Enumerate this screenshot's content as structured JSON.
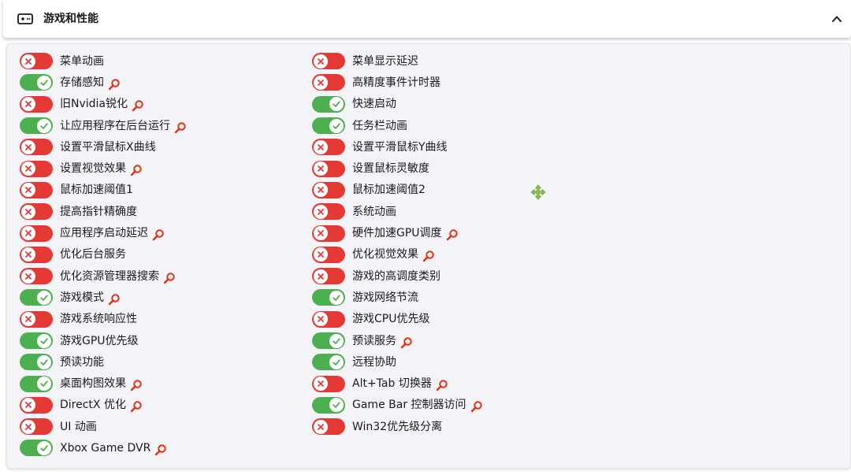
{
  "header": {
    "title": "游戏和性能",
    "icon": "gamepad-icon",
    "collapse_icon": "chevron-up-icon"
  },
  "colors": {
    "on": "#4caf50",
    "off": "#e53935",
    "search": "#e03010"
  },
  "left_items": [
    {
      "label": "菜单动画",
      "on": false,
      "search": false
    },
    {
      "label": "存储感知",
      "on": true,
      "search": true
    },
    {
      "label": "旧Nvidia锐化",
      "on": false,
      "search": true
    },
    {
      "label": "让应用程序在后台运行",
      "on": true,
      "search": true
    },
    {
      "label": "设置平滑鼠标X曲线",
      "on": false,
      "search": false
    },
    {
      "label": "设置视觉效果",
      "on": false,
      "search": true
    },
    {
      "label": "鼠标加速阈值1",
      "on": false,
      "search": false
    },
    {
      "label": "提高指针精确度",
      "on": false,
      "search": false
    },
    {
      "label": "应用程序启动延迟",
      "on": false,
      "search": true
    },
    {
      "label": "优化后台服务",
      "on": false,
      "search": false
    },
    {
      "label": "优化资源管理器搜索",
      "on": false,
      "search": true
    },
    {
      "label": "游戏模式",
      "on": true,
      "search": true
    },
    {
      "label": "游戏系统响应性",
      "on": false,
      "search": false
    },
    {
      "label": "游戏GPU优先级",
      "on": true,
      "search": false
    },
    {
      "label": "预读功能",
      "on": true,
      "search": false
    },
    {
      "label": "桌面构图效果",
      "on": true,
      "search": true
    },
    {
      "label": "DirectX 优化",
      "on": false,
      "search": true
    },
    {
      "label": "UI 动画",
      "on": false,
      "search": false
    },
    {
      "label": "Xbox Game DVR",
      "on": true,
      "search": true
    }
  ],
  "right_items": [
    {
      "label": "菜单显示延迟",
      "on": false,
      "search": false
    },
    {
      "label": "高精度事件计时器",
      "on": false,
      "search": false
    },
    {
      "label": "快速启动",
      "on": true,
      "search": false
    },
    {
      "label": "任务栏动画",
      "on": true,
      "search": false
    },
    {
      "label": "设置平滑鼠标Y曲线",
      "on": false,
      "search": false
    },
    {
      "label": "设置鼠标灵敏度",
      "on": false,
      "search": false
    },
    {
      "label": "鼠标加速阈值2",
      "on": false,
      "search": false
    },
    {
      "label": "系统动画",
      "on": false,
      "search": false
    },
    {
      "label": "硬件加速GPU调度",
      "on": false,
      "search": true
    },
    {
      "label": "优化视觉效果",
      "on": false,
      "search": true
    },
    {
      "label": "游戏的高调度类别",
      "on": false,
      "search": false
    },
    {
      "label": "游戏网络节流",
      "on": true,
      "search": false
    },
    {
      "label": "游戏CPU优先级",
      "on": false,
      "search": false
    },
    {
      "label": "预读服务",
      "on": true,
      "search": true
    },
    {
      "label": "远程协助",
      "on": true,
      "search": false
    },
    {
      "label": "Alt+Tab 切换器",
      "on": false,
      "search": true
    },
    {
      "label": "Game Bar 控制器访问",
      "on": true,
      "search": true
    },
    {
      "label": "Win32优先级分离",
      "on": false,
      "search": false
    }
  ]
}
